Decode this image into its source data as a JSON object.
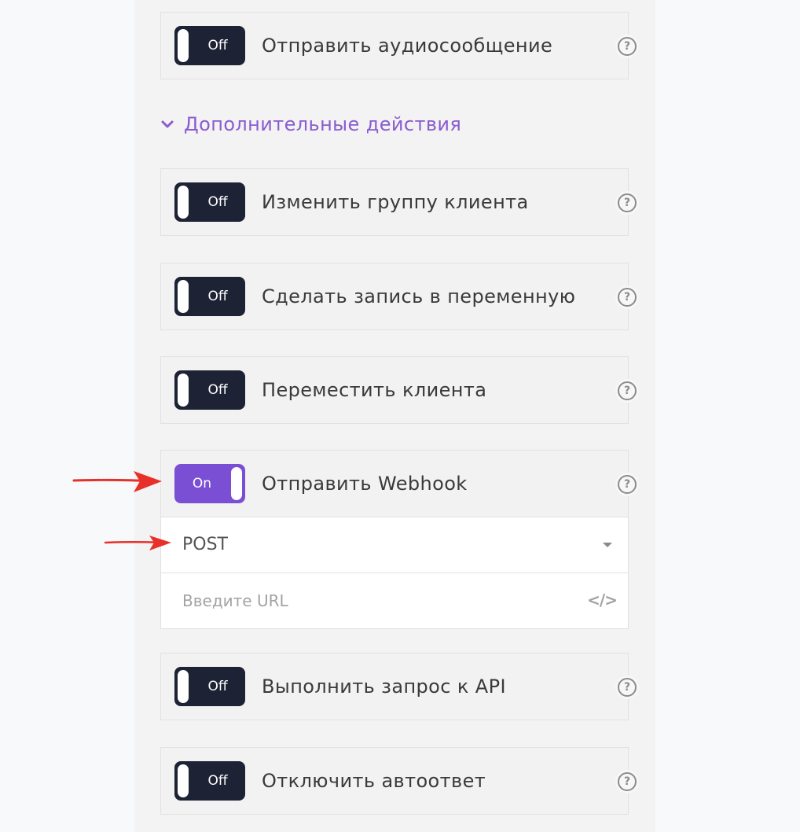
{
  "toggle_states": {
    "off": "Off",
    "on": "On"
  },
  "actions_top": [
    {
      "label": "Отправить аудиосообщение",
      "state": "Off"
    }
  ],
  "section": {
    "title": "Дополнительные действия"
  },
  "actions": [
    {
      "label": "Изменить группу клиента",
      "state": "Off"
    },
    {
      "label": "Сделать запись в переменную",
      "state": "Off"
    },
    {
      "label": "Переместить клиента",
      "state": "Off"
    },
    {
      "label": "Отправить Webhook",
      "state": "On"
    },
    {
      "label": "Выполнить запрос к API",
      "state": "Off"
    },
    {
      "label": "Отключить автоответ",
      "state": "Off"
    }
  ],
  "webhook": {
    "method": "POST",
    "url_placeholder": "Введите URL"
  },
  "help_glyph": "?",
  "code_glyph": "</>",
  "colors": {
    "toggle_off": "#1d2235",
    "toggle_on": "#7b4fd4",
    "section_title": "#8a5cd0",
    "annotation_arrow": "#e8302a"
  },
  "icons": {
    "help": "question-circle-icon",
    "chevron": "chevron-down-icon",
    "code": "code-icon",
    "dropdown": "caret-down-icon"
  }
}
